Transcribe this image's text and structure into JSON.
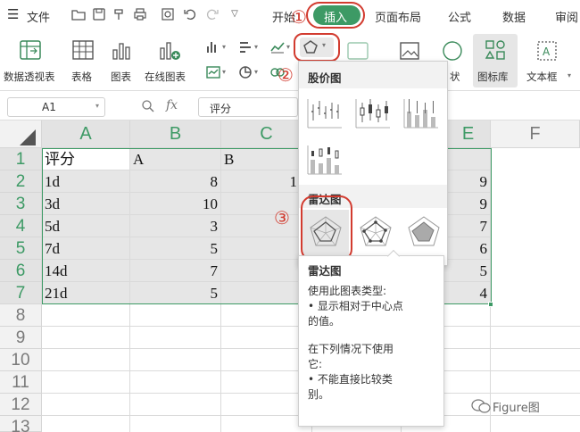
{
  "menubar": {
    "hamburger": "☰",
    "file": "文件",
    "tabs": [
      "开始",
      "插入",
      "页面布局",
      "公式",
      "数据",
      "审阅"
    ],
    "active_tab": "插入"
  },
  "ribbon": {
    "pivot": "数据透视表",
    "table": "表格",
    "chart": "图表",
    "online_chart": "在线图表",
    "chart_partial": "状",
    "gallery": "图标库",
    "textbox": "文本框"
  },
  "formula_bar": {
    "cell_ref": "A1",
    "fx": "fx",
    "value": "评分"
  },
  "columns": [
    "A",
    "B",
    "C",
    "D",
    "E",
    "F"
  ],
  "rows": [
    "1",
    "2",
    "3",
    "4",
    "5",
    "6",
    "7",
    "8",
    "9",
    "10",
    "11",
    "12",
    "13"
  ],
  "cells": {
    "a": [
      "评分",
      "1d",
      "3d",
      "5d",
      "7d",
      "14d",
      "21d"
    ],
    "b": [
      "A",
      "8",
      "10",
      "3",
      "5",
      "7",
      "5"
    ],
    "c1": "B",
    "c2": "1",
    "e": [
      "",
      "9",
      "9",
      "7",
      "6",
      "5",
      "4"
    ]
  },
  "dropdown": {
    "stock_title": "股价图",
    "radar_title": "雷达图"
  },
  "tooltip": {
    "title": "雷达图",
    "line1": "使用此图表类型:",
    "line2": "• 显示相对于中心点",
    "line3": "的值。",
    "line4": "在下列情况下使用",
    "line5": "它:",
    "line6": "• 不能直接比较类",
    "line7": "别。"
  },
  "annotations": {
    "n1": "①",
    "n2": "②",
    "n3": "③"
  },
  "watermark": "Figure图",
  "colors": {
    "accent": "#3d9a65",
    "annotation_red": "#d23b2f"
  }
}
